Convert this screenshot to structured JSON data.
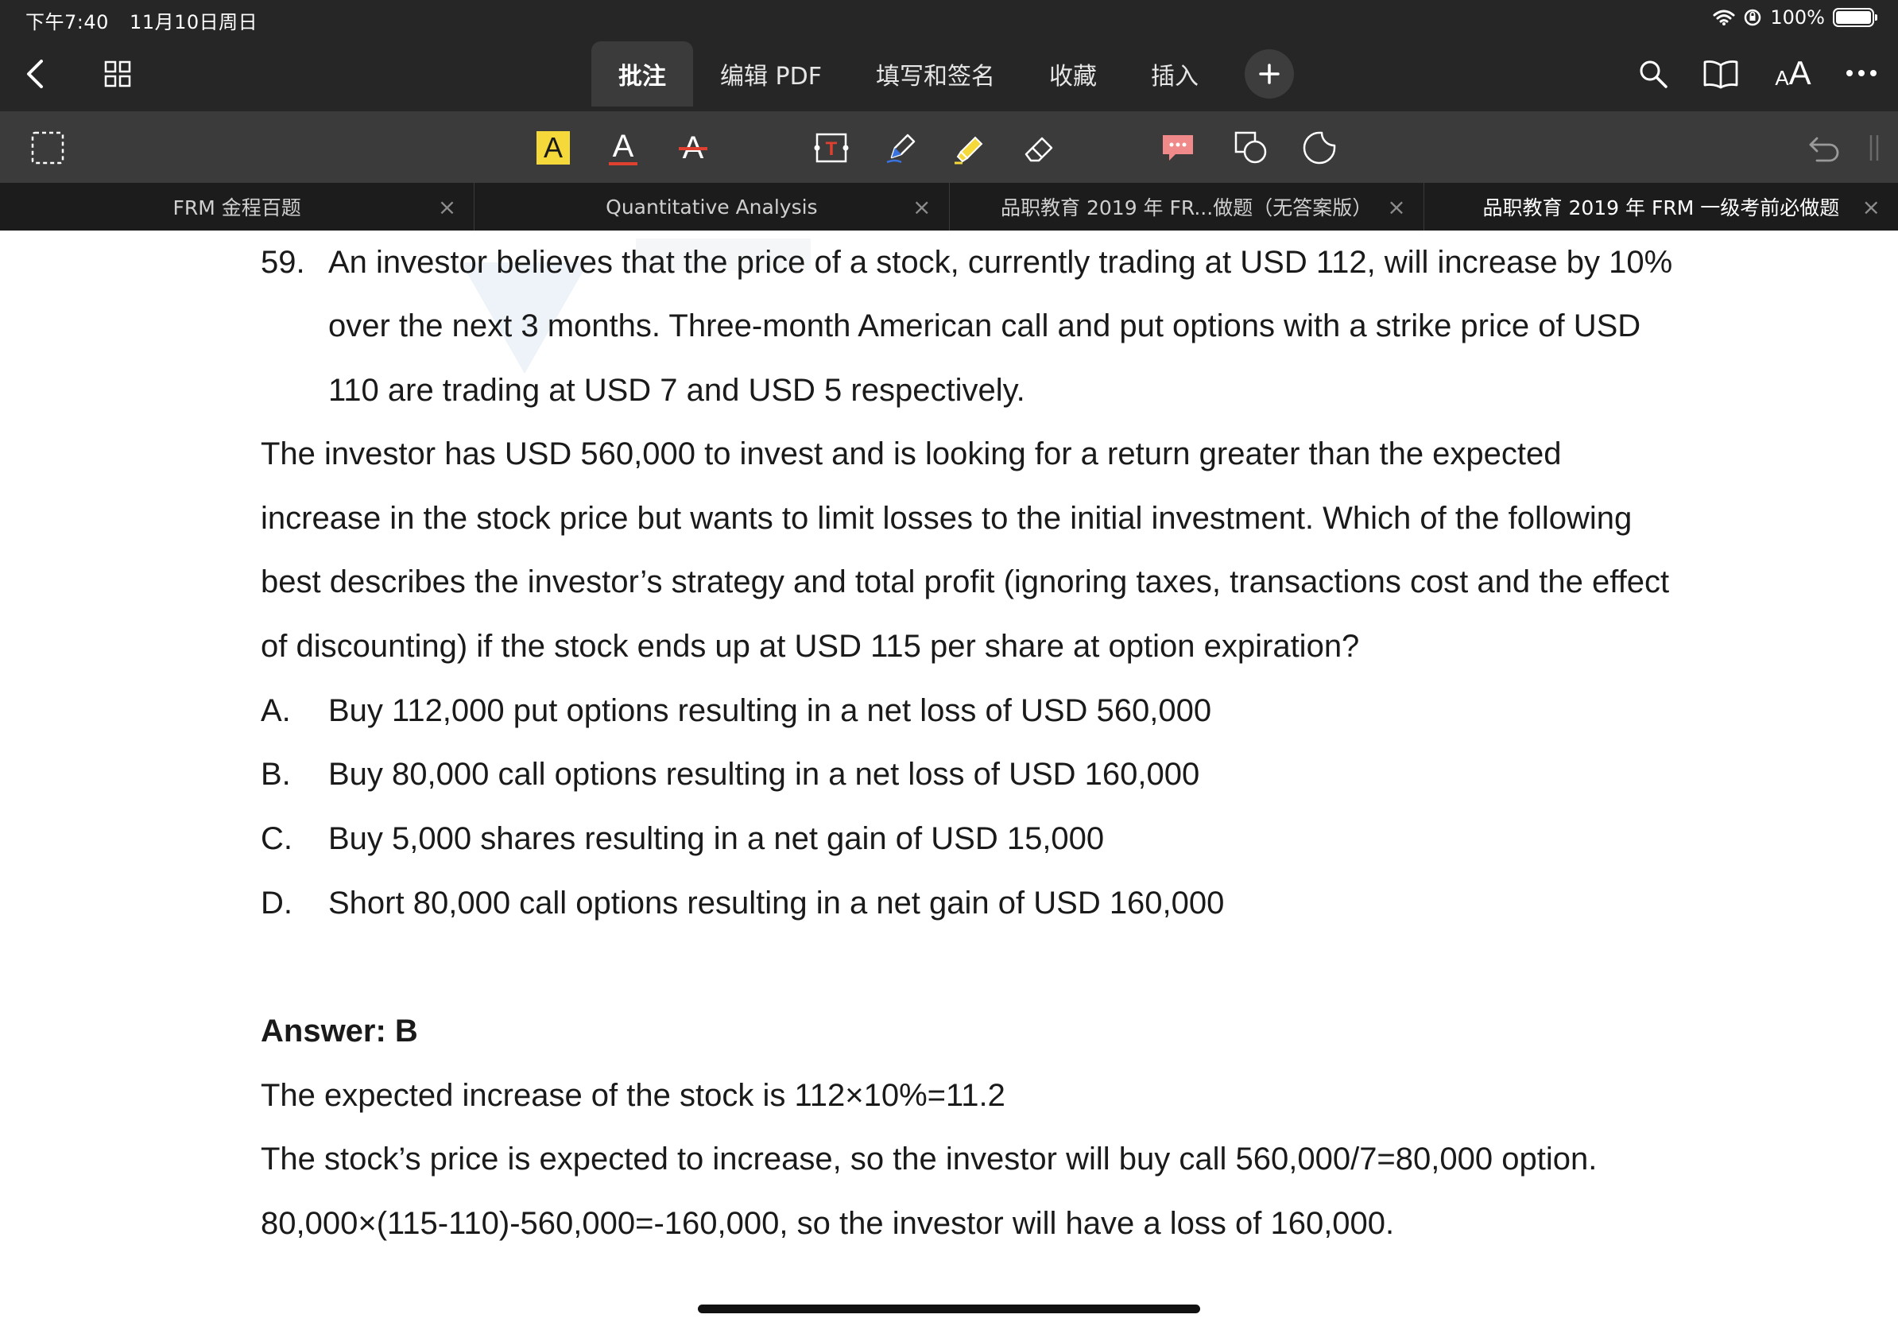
{
  "status": {
    "time": "下午7:40",
    "date": "11月10日周日",
    "battery": "100%"
  },
  "nav": {
    "tabs": [
      {
        "label": "批注",
        "active": true
      },
      {
        "label": "编辑 PDF",
        "active": false
      },
      {
        "label": "填写和签名",
        "active": false
      },
      {
        "label": "收藏",
        "active": false
      },
      {
        "label": "插入",
        "active": false
      }
    ],
    "font_size_label": "AA"
  },
  "toolbar": {
    "highlight_letter": "A",
    "underline_letter": "A",
    "strike_letter": "A",
    "textbox_letter": "T"
  },
  "doc_tabs": [
    {
      "label": "FRM 金程百题",
      "active": false
    },
    {
      "label": "Quantitative Analysis",
      "active": false
    },
    {
      "label": "品职教育 2019 年 FR...做题（无答案版）",
      "active": false
    },
    {
      "label": "品职教育 2019 年 FRM 一级考前必做题",
      "active": true
    }
  ],
  "question": {
    "number": "59.",
    "stem_lines": [
      "An investor believes that the price of a stock, currently trading at USD 112, will increase by 10%",
      "over the next 3 months. Three-month American call and put options with a strike price of USD",
      "110 are trading at USD 7 and USD 5 respectively."
    ],
    "body_lines": [
      "The investor has USD 560,000 to invest and is looking for a return greater than the expected",
      "increase in the stock price but wants to limit losses to the initial investment. Which of the following",
      "best describes the investor’s strategy and total profit (ignoring taxes, transactions cost and the effect",
      "of discounting) if the stock ends up at USD 115 per share at option expiration?"
    ],
    "options": [
      {
        "letter": "A.",
        "text": "Buy 112,000 put options resulting in a net loss of USD 560,000"
      },
      {
        "letter": "B.",
        "text": "Buy 80,000 call options resulting in a net loss of USD 160,000"
      },
      {
        "letter": "C.",
        "text": "Buy 5,000 shares resulting in a net gain of USD 15,000"
      },
      {
        "letter": "D.",
        "text": "Short 80,000 call options resulting in a net gain of USD 160,000"
      }
    ]
  },
  "answer": {
    "label": "Answer: B",
    "lines": [
      "The expected increase of the stock is 112×10%=11.2",
      "The stock’s price is expected to increase, so the investor will buy call 560,000/7=80,000 option.",
      "80,000×(115-110)-560,000=-160,000, so the investor will have a loss of 160,000."
    ]
  },
  "colors": {
    "chrome_dark": "#262626",
    "toolbar_gray": "#3b3b3b",
    "highlight_yellow": "#f5d83a",
    "underline_red": "#e0402f",
    "comment_pink": "#f08a8a"
  }
}
